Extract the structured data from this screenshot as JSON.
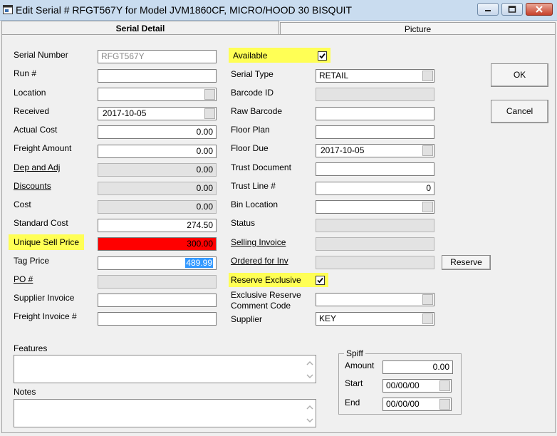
{
  "window": {
    "title": "Edit Serial # RFGT567Y for Model JVM1860CF, MICRO/HOOD 30 BISQUIT"
  },
  "tabs": [
    {
      "label": "Serial Detail",
      "active": true
    },
    {
      "label": "Picture",
      "active": false
    }
  ],
  "left": {
    "serial_number": {
      "label": "Serial Number",
      "value": "RFGT567Y"
    },
    "run": {
      "label": "Run #",
      "value": ""
    },
    "location": {
      "label": "Location",
      "value": ""
    },
    "received": {
      "label": "Received",
      "value": "2017-10-05"
    },
    "actual_cost": {
      "label": "Actual Cost",
      "value": "0.00"
    },
    "freight_amount": {
      "label": "Freight Amount",
      "value": "0.00"
    },
    "dep_and_adj": {
      "label": "Dep and Adj",
      "value": "0.00"
    },
    "discounts": {
      "label": "Discounts",
      "value": "0.00"
    },
    "cost": {
      "label": "Cost",
      "value": "0.00"
    },
    "standard_cost": {
      "label": "Standard Cost",
      "value": "274.50"
    },
    "unique_sell_price": {
      "label": "Unique Sell Price",
      "value": "300.00"
    },
    "tag_price": {
      "label": "Tag Price",
      "value": "489.99"
    },
    "po": {
      "label": "PO #",
      "value": ""
    },
    "supplier_invoice": {
      "label": "Supplier Invoice",
      "value": ""
    },
    "freight_invoice": {
      "label": "Freight Invoice #",
      "value": ""
    }
  },
  "right": {
    "available": {
      "label": "Available",
      "checked": true
    },
    "serial_type": {
      "label": "Serial Type",
      "value": "RETAIL"
    },
    "barcode_id": {
      "label": "Barcode ID",
      "value": ""
    },
    "raw_barcode": {
      "label": "Raw Barcode",
      "value": ""
    },
    "floor_plan": {
      "label": "Floor Plan",
      "value": ""
    },
    "floor_due": {
      "label": "Floor Due",
      "value": "2017-10-05"
    },
    "trust_document": {
      "label": "Trust Document",
      "value": ""
    },
    "trust_line": {
      "label": "Trust Line #",
      "value": "0"
    },
    "bin_location": {
      "label": "Bin Location",
      "value": ""
    },
    "status": {
      "label": "Status",
      "value": ""
    },
    "selling_invoice": {
      "label": "Selling Invoice",
      "value": ""
    },
    "ordered_for_inv": {
      "label": "Ordered for Inv",
      "value": ""
    },
    "reserve_button": "Reserve",
    "reserve_exclusive": {
      "label": "Reserve Exclusive",
      "checked": true
    },
    "exclusive_comment": {
      "label_line1": "Exclusive Reserve",
      "label_line2": "Comment Code",
      "value": ""
    },
    "supplier": {
      "label": "Supplier",
      "value": "KEY"
    }
  },
  "buttons": {
    "ok": "OK",
    "cancel": "Cancel"
  },
  "features": {
    "label": "Features",
    "value": ""
  },
  "notes": {
    "label": "Notes",
    "value": ""
  },
  "spiff": {
    "title": "Spiff",
    "amount": {
      "label": "Amount",
      "value": "0.00"
    },
    "start": {
      "label": "Start",
      "value": "00/00/00"
    },
    "end": {
      "label": "End",
      "value": "00/00/00"
    }
  },
  "colors": {
    "highlight": "#ffff55",
    "unique_sell_price_bg": "#ff0000",
    "selection": "#3399ff"
  }
}
